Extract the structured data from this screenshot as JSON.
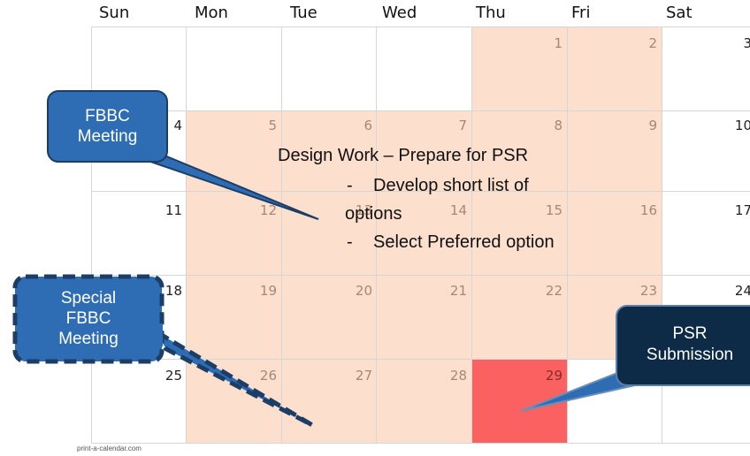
{
  "calendar": {
    "weekdays": [
      "Sun",
      "Mon",
      "Tue",
      "Wed",
      "Thu",
      "Fri",
      "Sat"
    ],
    "weeks": [
      [
        "",
        "",
        "",
        "",
        "1",
        "2",
        "3"
      ],
      [
        "4",
        "5",
        "6",
        "7",
        "8",
        "9",
        "10"
      ],
      [
        "11",
        "12",
        "13",
        "14",
        "15",
        "16",
        "17"
      ],
      [
        "18",
        "19",
        "20",
        "21",
        "22",
        "23",
        "24"
      ],
      [
        "25",
        "26",
        "27",
        "28",
        "29",
        "",
        ""
      ]
    ],
    "footer": "print-a-calendar.com"
  },
  "annotations": {
    "fbbc_meeting": "FBBC\nMeeting",
    "special_fbbc_meeting": "Special\nFBBC\nMeeting",
    "psr_submission": "PSR\nSubmission",
    "design_title": "Design Work – Prepare for PSR",
    "bullet1_line1": "Develop short list of",
    "bullet1_line2": "options",
    "bullet2": "Select Preferred option",
    "bullet_marker": "-"
  },
  "colors": {
    "shade": "#fbd9c4",
    "highlight_red": "#fb6161",
    "callout_blue": "#2e6db4",
    "callout_navy": "#0d2a47"
  }
}
